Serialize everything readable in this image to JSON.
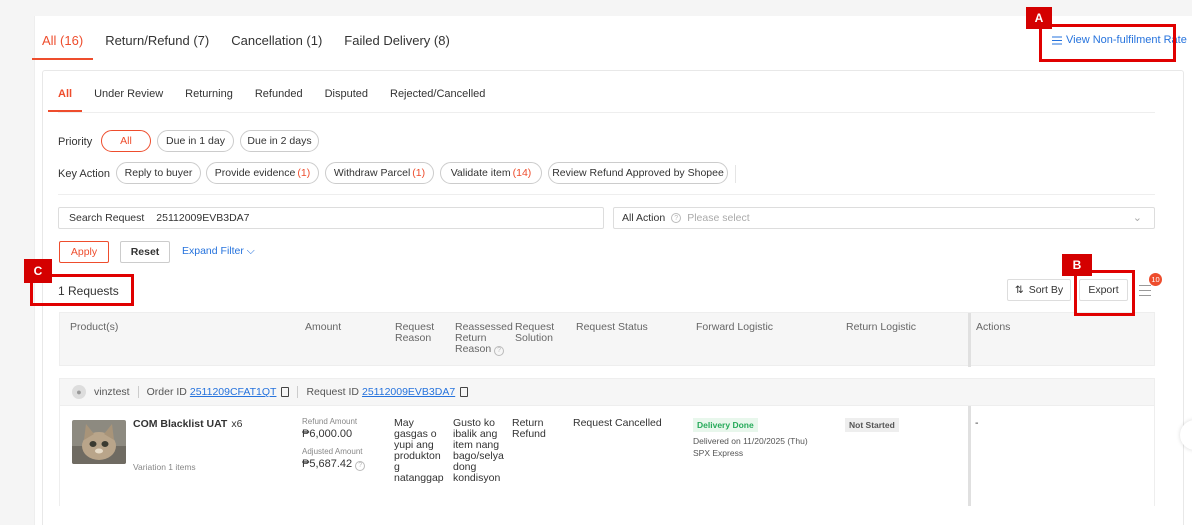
{
  "top_tabs": [
    {
      "label": "All (16)"
    },
    {
      "label": "Return/Refund (7)"
    },
    {
      "label": "Cancellation (1)"
    },
    {
      "label": "Failed Delivery (8)"
    }
  ],
  "nfr_link": "View Non-fulfilment Rate",
  "sub_tabs": [
    {
      "label": "All"
    },
    {
      "label": "Under Review"
    },
    {
      "label": "Returning"
    },
    {
      "label": "Refunded"
    },
    {
      "label": "Disputed"
    },
    {
      "label": "Rejected/Cancelled"
    }
  ],
  "priority": {
    "label": "Priority",
    "options": [
      "All",
      "Due in 1 day",
      "Due in 2 days"
    ]
  },
  "key_action": {
    "label": "Key Action",
    "options": [
      {
        "label": "Reply to buyer",
        "count": ""
      },
      {
        "label": "Provide evidence",
        "count": "(1)"
      },
      {
        "label": "Withdraw Parcel",
        "count": "(1)"
      },
      {
        "label": "Validate item",
        "count": "(14)"
      },
      {
        "label": "Review Refund Approved by Shopee",
        "count": ""
      }
    ]
  },
  "search": {
    "label": "Search Request",
    "value": "25112009EVB3DA7"
  },
  "action_filter": {
    "label": "All Action",
    "placeholder": "Please select"
  },
  "buttons": {
    "apply": "Apply",
    "reset": "Reset",
    "expand": "Expand Filter",
    "sort": "Sort By",
    "export": "Export"
  },
  "request_count": "1 Requests",
  "menu_badge": "10",
  "columns": {
    "products": "Product(s)",
    "amount": "Amount",
    "reason": "Request Reason",
    "reassessed": "Reassessed Return Reason",
    "solution": "Request Solution",
    "status": "Request Status",
    "forward": "Forward Logistic",
    "return": "Return Logistic",
    "actions": "Actions"
  },
  "order": {
    "buyer": "vinztest",
    "order_label": "Order ID",
    "order_id": "2511209CFAT1QT",
    "request_label": "Request ID",
    "request_id": "25112009EVB3DA7"
  },
  "row": {
    "product_name": "COM Blacklist UAT",
    "qty": "x6",
    "variation": "Variation 1 items",
    "refund_label": "Refund Amount",
    "refund_amount": "₱6,000.00",
    "adjusted_label": "Adjusted Amount",
    "adjusted_amount": "₱5,687.42",
    "reason": "May gasgas o yupi ang produkton g natanggap",
    "reassessed": "Gusto ko ibalik ang item nang bago/selya dong kondisyon",
    "solution": "Return Refund",
    "status": "Request Cancelled",
    "forward_tag": "Delivery Done",
    "forward_date": "Delivered on 11/20/2025 (Thu)",
    "forward_carrier": "SPX Express",
    "return_tag": "Not Started",
    "actions": "-"
  },
  "annotations": {
    "a": "A",
    "b": "B",
    "c": "C"
  },
  "colors": {
    "accent": "#ee4d2d",
    "link": "#2673dd",
    "annotation": "#e00000"
  }
}
